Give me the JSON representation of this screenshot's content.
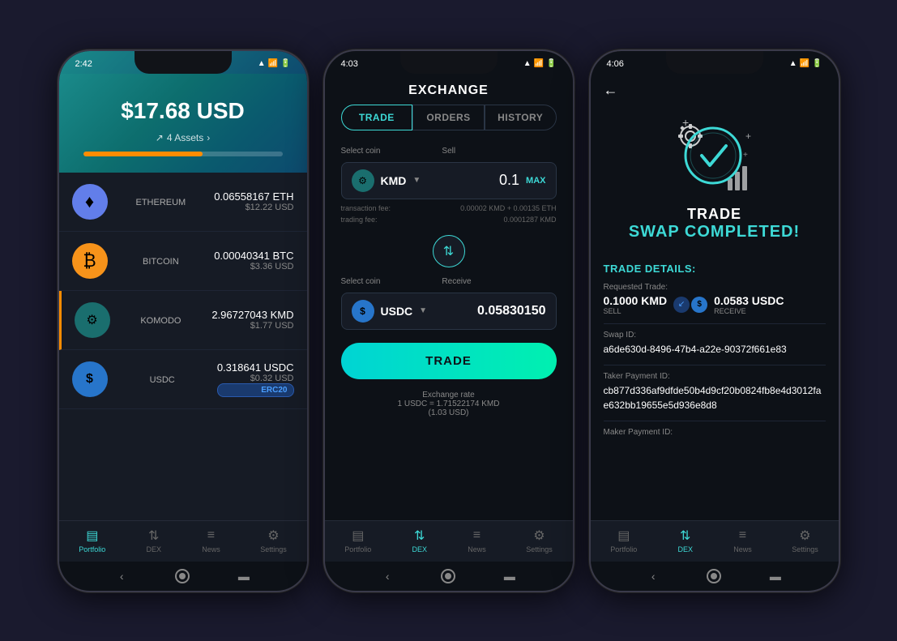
{
  "phones": [
    {
      "id": "phone1",
      "status_time": "2:42",
      "header": {
        "amount": "$17.68 USD",
        "assets_label": "4 Assets"
      },
      "coins": [
        {
          "id": "eth",
          "symbol": "ETH",
          "name": "ETHEREUM",
          "amount": "0.06558167 ETH",
          "usd": "$12.22 USD",
          "icon": "♦",
          "badge": null
        },
        {
          "id": "btc",
          "symbol": "BTC",
          "name": "BITCOIN",
          "amount": "0.00040341 BTC",
          "usd": "$3.36 USD",
          "icon": "₿",
          "badge": null
        },
        {
          "id": "kmd",
          "symbol": "KMD",
          "name": "KOMODO",
          "amount": "2.96727043 KMD",
          "usd": "$1.77 USD",
          "icon": "⚙",
          "badge": null
        },
        {
          "id": "usdc",
          "symbol": "USDC",
          "name": "USDC",
          "amount": "0.318641 USDC",
          "usd": "$0.32 USD",
          "icon": "$",
          "badge": "ERC20"
        }
      ],
      "nav": [
        {
          "id": "portfolio",
          "label": "Portfolio",
          "active": true
        },
        {
          "id": "dex",
          "label": "DEX",
          "active": false
        },
        {
          "id": "news",
          "label": "News",
          "active": false
        },
        {
          "id": "settings",
          "label": "Settings",
          "active": false
        }
      ]
    },
    {
      "id": "phone2",
      "status_time": "4:03",
      "title": "EXCHANGE",
      "tabs": [
        {
          "id": "trade",
          "label": "TRADE",
          "active": true
        },
        {
          "id": "orders",
          "label": "ORDERS",
          "active": false
        },
        {
          "id": "history",
          "label": "HISTORY",
          "active": false
        }
      ],
      "sell_section": {
        "select_label": "Select coin",
        "sell_label": "Sell",
        "coin": "KMD",
        "value": "0.1",
        "max_label": "MAX",
        "transaction_fee_label": "transaction fee:",
        "transaction_fee_value": "0.00002 KMD + 0.00135 ETH",
        "trading_fee_label": "trading fee:",
        "trading_fee_value": "0.0001287 KMD"
      },
      "receive_section": {
        "select_label": "Select coin",
        "receive_label": "Receive",
        "coin": "USDC",
        "value": "0.05830150"
      },
      "trade_btn_label": "TRADE",
      "exchange_rate_label": "Exchange rate",
      "exchange_rate_value": "1 USDC = 1.71522174 KMD",
      "exchange_rate_usd": "(1.03 USD)",
      "nav": [
        {
          "id": "portfolio",
          "label": "Portfolio",
          "active": false
        },
        {
          "id": "dex",
          "label": "DEX",
          "active": true
        },
        {
          "id": "news",
          "label": "News",
          "active": false
        },
        {
          "id": "settings",
          "label": "Settings",
          "active": false
        }
      ]
    },
    {
      "id": "phone3",
      "status_time": "4:06",
      "trade_label": "TRADE",
      "swap_completed_label": "SWAP COMPLETED!",
      "details_title": "TRADE DETAILS:",
      "requested_trade_label": "Requested Trade:",
      "sell_amount": "0.1000 KMD",
      "sell_label": "Sell",
      "receive_amount": "0.0583 USDC",
      "receive_label": "RECEIVE",
      "swap_id_label": "Swap ID:",
      "swap_id_value": "a6de630d-8496-47b4-a22e-90372f661e83",
      "taker_payment_label": "Taker Payment ID:",
      "taker_payment_value": "cb877d336af9dfde50b4d9cf20b0824fb8e4d3012fae632bb19655e5d936e8d8",
      "maker_payment_label": "Maker Payment ID:",
      "nav": [
        {
          "id": "portfolio",
          "label": "Portfolio",
          "active": false
        },
        {
          "id": "dex",
          "label": "DEX",
          "active": true
        },
        {
          "id": "news",
          "label": "News",
          "active": false
        },
        {
          "id": "settings",
          "label": "Settings",
          "active": false
        }
      ]
    }
  ],
  "colors": {
    "teal": "#3dd9d6",
    "dark_bg": "#0d1117",
    "card_bg": "#161b25",
    "border": "#2a3545",
    "text_primary": "#ffffff",
    "text_secondary": "#888888"
  }
}
